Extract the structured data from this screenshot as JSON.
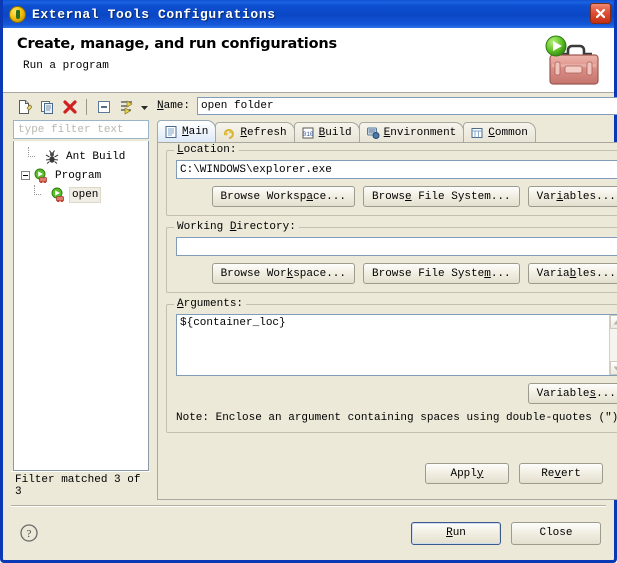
{
  "window": {
    "title": "External Tools Configurations",
    "title_icon": "eclipse-external-tools-icon",
    "close_label": "close-icon"
  },
  "banner": {
    "title": "Create, manage, and run configurations",
    "subtitle": "Run a program",
    "icon": "toolbox-with-run-arrow-icon"
  },
  "toolbar": {
    "buttons": [
      {
        "name": "new-launch-configuration",
        "icon": "new-document-icon"
      },
      {
        "name": "duplicate-launch-configuration",
        "icon": "copy-icon"
      },
      {
        "name": "delete-launch-configuration",
        "icon": "red-x-icon"
      },
      {
        "name": "collapse-all",
        "icon": "collapse-all-icon"
      },
      {
        "name": "filter-configurations",
        "icon": "filter-icon"
      },
      {
        "name": "view-menu",
        "icon": "chevron-down-icon"
      }
    ]
  },
  "filter": {
    "placeholder": "type filter text",
    "value": "",
    "status": "Filter matched 3 of 3"
  },
  "tree": {
    "items": [
      {
        "label": "Ant Build",
        "icon": "ant-icon",
        "level": 1,
        "expander": false,
        "selected": false
      },
      {
        "label": "Program",
        "icon": "program-icon",
        "level": 1,
        "expander": true,
        "selected": false
      },
      {
        "label": "open",
        "icon": "program-icon",
        "level": 2,
        "expander": false,
        "selected": true
      }
    ]
  },
  "name_field": {
    "label": "Name:",
    "label_mnemonic": "N",
    "value": "open folder"
  },
  "tabs": [
    {
      "label": "Main",
      "mnemonic": "M",
      "icon": "main-document-icon",
      "active": true
    },
    {
      "label": "Refresh",
      "mnemonic": "R",
      "icon": "refresh-arrows-icon",
      "active": false
    },
    {
      "label": "Build",
      "mnemonic": "B",
      "icon": "build-binary-icon",
      "active": false
    },
    {
      "label": "Environment",
      "mnemonic": "E",
      "icon": "environment-monitor-icon",
      "active": false
    },
    {
      "label": "Common",
      "mnemonic": "C",
      "icon": "common-table-icon",
      "active": false
    }
  ],
  "main_tab": {
    "location": {
      "title": "Location:",
      "title_mnemonic": "L",
      "value": "C:\\WINDOWS\\explorer.exe",
      "buttons": [
        {
          "label": "Browse Workspace...",
          "mnemonic": "a"
        },
        {
          "label": "Browse File System...",
          "mnemonic": "e"
        },
        {
          "label": "Variables...",
          "mnemonic": "i"
        }
      ]
    },
    "working_directory": {
      "title": "Working Directory:",
      "title_mnemonic": "D",
      "value": "",
      "buttons": [
        {
          "label": "Browse Workspace...",
          "mnemonic": "k"
        },
        {
          "label": "Browse File System...",
          "mnemonic": "m"
        },
        {
          "label": "Variables...",
          "mnemonic": "b"
        }
      ]
    },
    "arguments": {
      "title": "Arguments:",
      "title_mnemonic": "A",
      "value": "${container_loc}",
      "variables_button": {
        "label": "Variables...",
        "mnemonic": "s"
      },
      "note": "Note: Enclose an argument containing spaces using double-quotes (\")."
    }
  },
  "apply_row": {
    "apply": {
      "label": "Apply",
      "mnemonic": "y"
    },
    "revert": {
      "label": "Revert",
      "mnemonic": "v"
    }
  },
  "footer": {
    "help_icon": "help-question-icon",
    "run": {
      "label": "Run",
      "mnemonic": "R"
    },
    "close": {
      "label": "Close"
    }
  },
  "colors": {
    "titlebar_blue": "#0b39b5",
    "dialog_bg": "#ece9d8",
    "field_border": "#7f9db9",
    "delete_red": "#d02020",
    "run_green": "#4caf20"
  }
}
